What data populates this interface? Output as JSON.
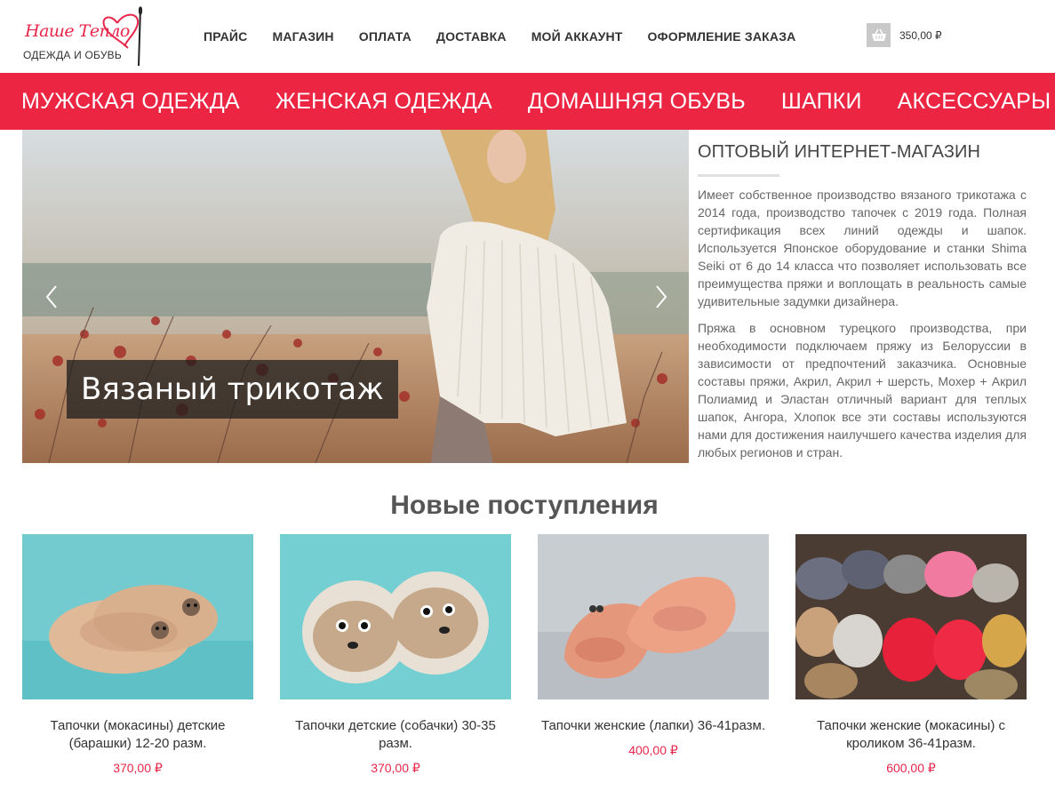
{
  "logo": {
    "script_text": "Наше Тепло",
    "subtitle": "ОДЕЖДА И ОБУВЬ"
  },
  "topnav": [
    {
      "label": "ПРАЙС"
    },
    {
      "label": "МАГАЗИН"
    },
    {
      "label": "ОПЛАТА"
    },
    {
      "label": "ДОСТАВКА"
    },
    {
      "label": "МОЙ АККАУНТ"
    },
    {
      "label": "ОФОРМЛЕНИЕ ЗАКАЗА"
    }
  ],
  "cart": {
    "icon": "basket-icon",
    "total": "350,00 ₽"
  },
  "categories": [
    {
      "label": "МУЖСКАЯ ОДЕЖДА"
    },
    {
      "label": "ЖЕНСКАЯ ОДЕЖДА"
    },
    {
      "label": "ДОМАШНЯЯ ОБУВЬ"
    },
    {
      "label": "ШАПКИ"
    },
    {
      "label": "АКСЕССУАРЫ"
    }
  ],
  "hero": {
    "caption": "Вязаный трикотаж",
    "prev_icon": "chevron-left-icon",
    "next_icon": "chevron-right-icon"
  },
  "about": {
    "title": "ОПТОВЫЙ ИНТЕРНЕТ-МАГАЗИН",
    "paragraphs": [
      "Имеет собственное производство вязаного трикотажа с 2014 года, производство тапочек с 2019 года. Полная сертификация всех линий одежды и шапок. Используется Японское оборудование и станки Shima Seiki от 6 до 14 класса что позволяет использовать все преимущества пряжи и воплощать в реальность самые удивительные задумки дизайнера.",
      "Пряжа в основном турецкого производства, при необходимости подключаем пряжу из Белоруссии в зависимости от предпочтений заказчика. Основные составы пряжи, Акрил, Акрил + шерсть, Мохер + Акрил Полиамид и Эластан отличный вариант для теплых шапок, Ангора, Хлопок все эти составы используются нами для достижения наилучшего качества изделия для любых регионов и стран."
    ]
  },
  "new_arrivals": {
    "title": "Новые поступления",
    "products": [
      {
        "name": "Тапочки (мокасины) детские (барашки) 12-20 разм.",
        "price": "370,00 ₽"
      },
      {
        "name": "Тапочки детские (собачки) 30-35 разм.",
        "price": "370,00 ₽"
      },
      {
        "name": "Тапочки женские (лапки) 36-41разм.",
        "price": "400,00 ₽"
      },
      {
        "name": "Тапочки женские (мокасины) с кроликом 36-41разм.",
        "price": "600,00 ₽"
      }
    ]
  },
  "colors": {
    "accent": "#ec2543",
    "price": "#e8264a"
  }
}
